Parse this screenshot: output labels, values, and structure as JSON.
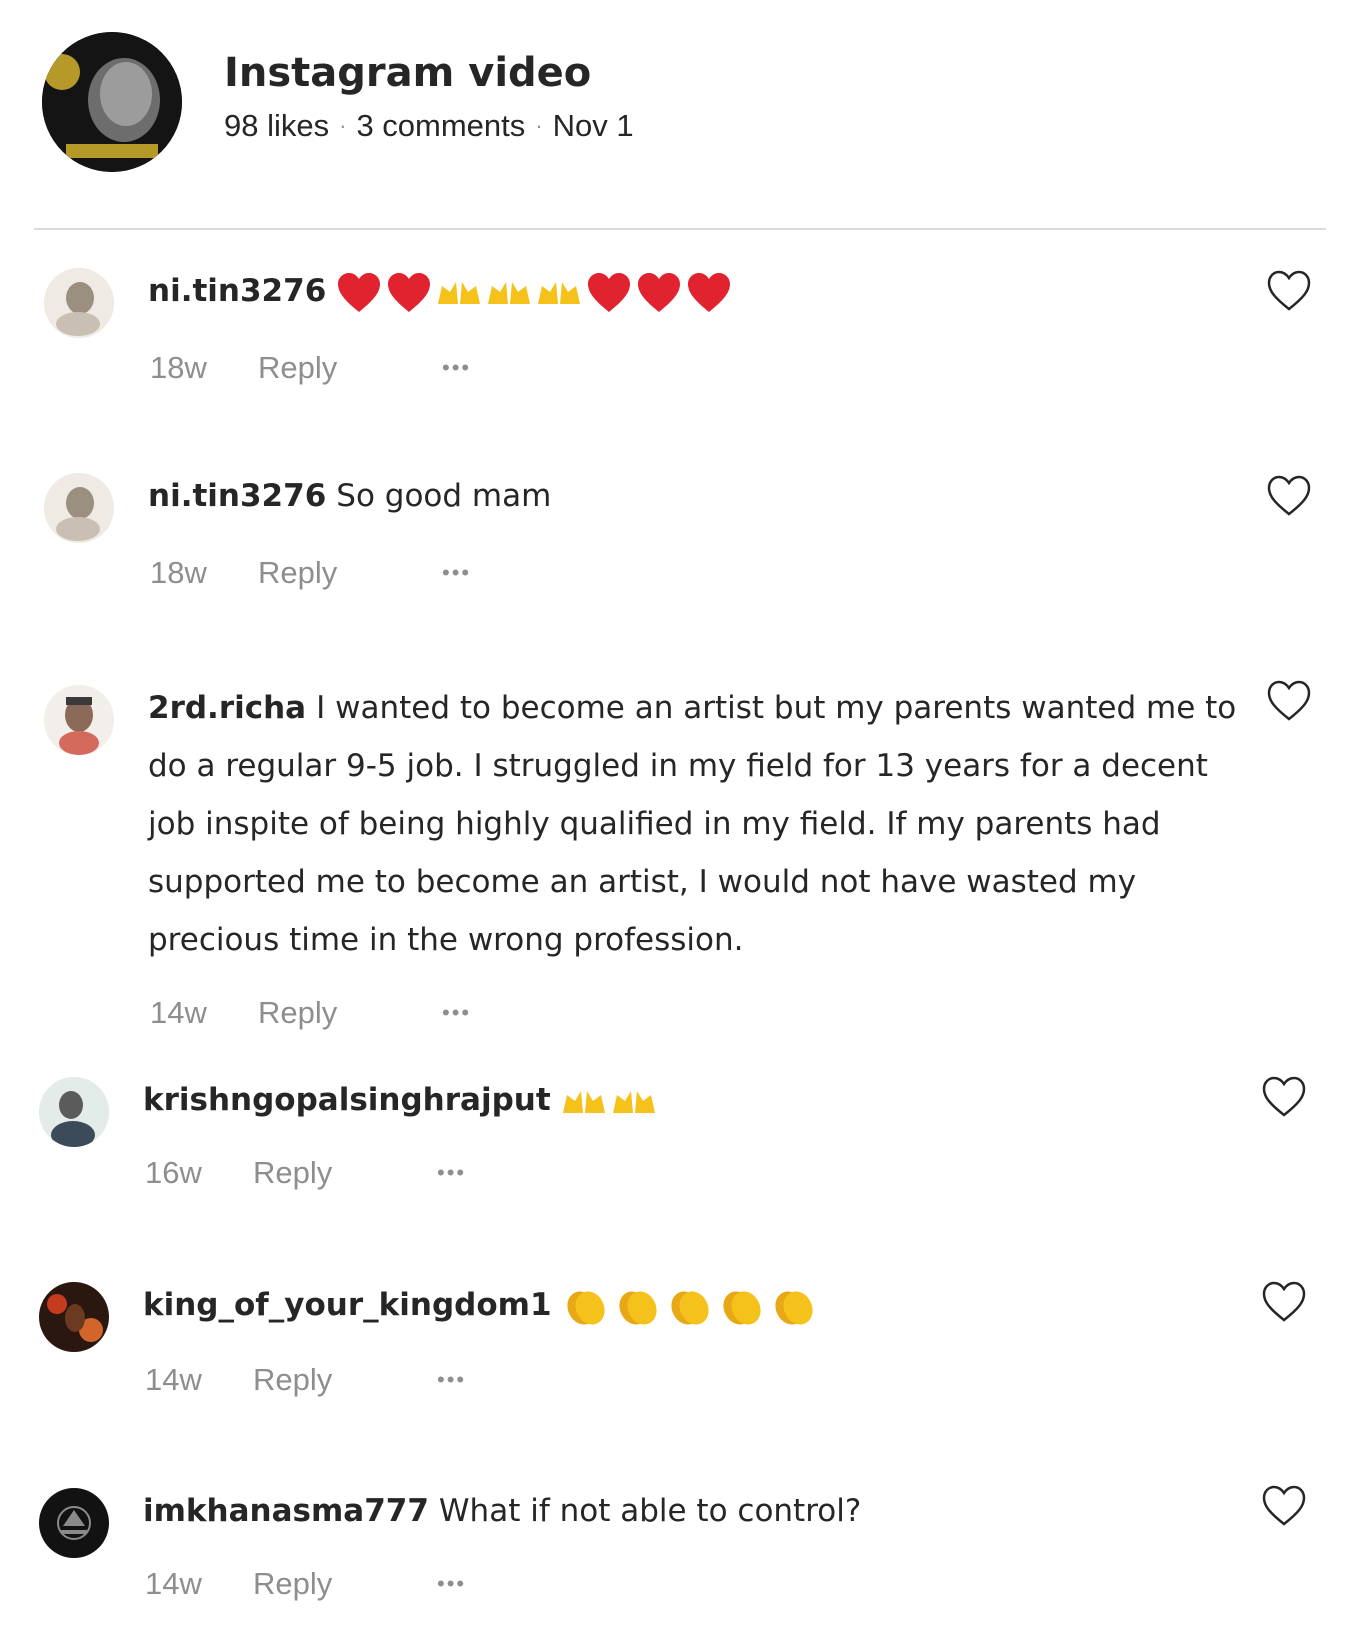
{
  "post": {
    "title": "Instagram video",
    "likes": "98 likes",
    "comments": "3 comments",
    "date": "Nov 1"
  },
  "colors": {
    "text": "#262626",
    "muted": "#8e8e8e",
    "divider": "#dbdbdb",
    "heart_red": "#e0232e",
    "emoji_yellow": "#f5c21b"
  },
  "comments": [
    {
      "username": "ni.tin3276",
      "text": "",
      "emoji": [
        "red-heart",
        "red-heart",
        "raising-hands",
        "raising-hands",
        "raising-hands",
        "red-heart",
        "red-heart",
        "red-heart"
      ],
      "time": "18w",
      "reply": "Reply",
      "more": "•••"
    },
    {
      "username": "ni.tin3276",
      "text": "So good mam",
      "emoji": [],
      "time": "18w",
      "reply": "Reply",
      "more": "•••"
    },
    {
      "username": "2rd.richa",
      "text": "I wanted to become an artist but my parents wanted me to do a regular 9-5 job. I struggled in my field for 13 years for a decent job inspite of being highly qualified in my field. If my parents had supported me to become an artist, I would not have wasted my precious time in the wrong profession.",
      "emoji": [],
      "time": "14w",
      "reply": "Reply",
      "more": "•••"
    },
    {
      "username": "krishngopalsinghrajput",
      "text": "",
      "emoji": [
        "raising-hands",
        "raising-hands"
      ],
      "time": "16w",
      "reply": "Reply",
      "more": "•••"
    },
    {
      "username": "king_of_your_kingdom1",
      "text": "",
      "emoji": [
        "clapping-hands",
        "clapping-hands",
        "clapping-hands",
        "clapping-hands",
        "clapping-hands"
      ],
      "time": "14w",
      "reply": "Reply",
      "more": "•••"
    },
    {
      "username": "imkhanasma777",
      "text": "What if not able to control?",
      "emoji": [],
      "time": "14w",
      "reply": "Reply",
      "more": "•••"
    }
  ]
}
